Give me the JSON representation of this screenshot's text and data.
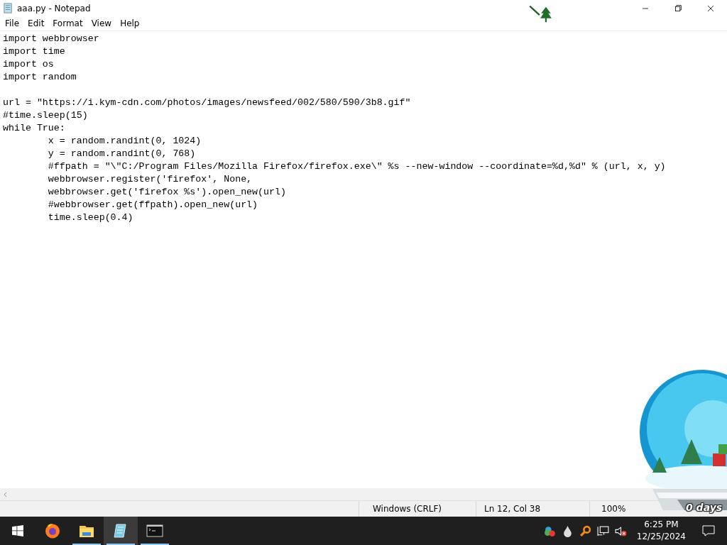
{
  "window": {
    "title": "aaa.py - Notepad"
  },
  "menu": [
    "File",
    "Edit",
    "Format",
    "View",
    "Help"
  ],
  "editor": {
    "text": "import webbrowser\nimport time\nimport os\nimport random\n\nurl = \"https://i.kym-cdn.com/photos/images/newsfeed/002/580/590/3b8.gif\"\n#time.sleep(15)\nwhile True:\n\tx = random.randint(0, 1024)\n\ty = random.randint(0, 768)\n\t#ffpath = \"\\\"C:/Program Files/Mozilla Firefox/firefox.exe\\\" %s --new-window --coordinate=%d,%d\" % (url, x, y)\n\twebbrowser.register('firefox', None,\n\twebbrowser.get('firefox %s').open_new(url)\n\t#webbrowser.get(ffpath).open_new(url)\n\ttime.sleep(0.4)"
  },
  "status_bar": {
    "line_ending": "Windows (CRLF)",
    "position": "Ln 12, Col 38",
    "zoom": "100%"
  },
  "taskbar": {
    "apps": [
      {
        "kind": "browser",
        "running": false,
        "selected": false
      },
      {
        "kind": "folder",
        "running": true,
        "selected": false
      },
      {
        "kind": "notepad",
        "running": true,
        "selected": true
      },
      {
        "kind": "terminal",
        "running": true,
        "selected": false
      }
    ],
    "clock": {
      "time": "6:25 PM",
      "date": "12/25/2024"
    }
  },
  "gadget": {
    "label": "0 days"
  }
}
